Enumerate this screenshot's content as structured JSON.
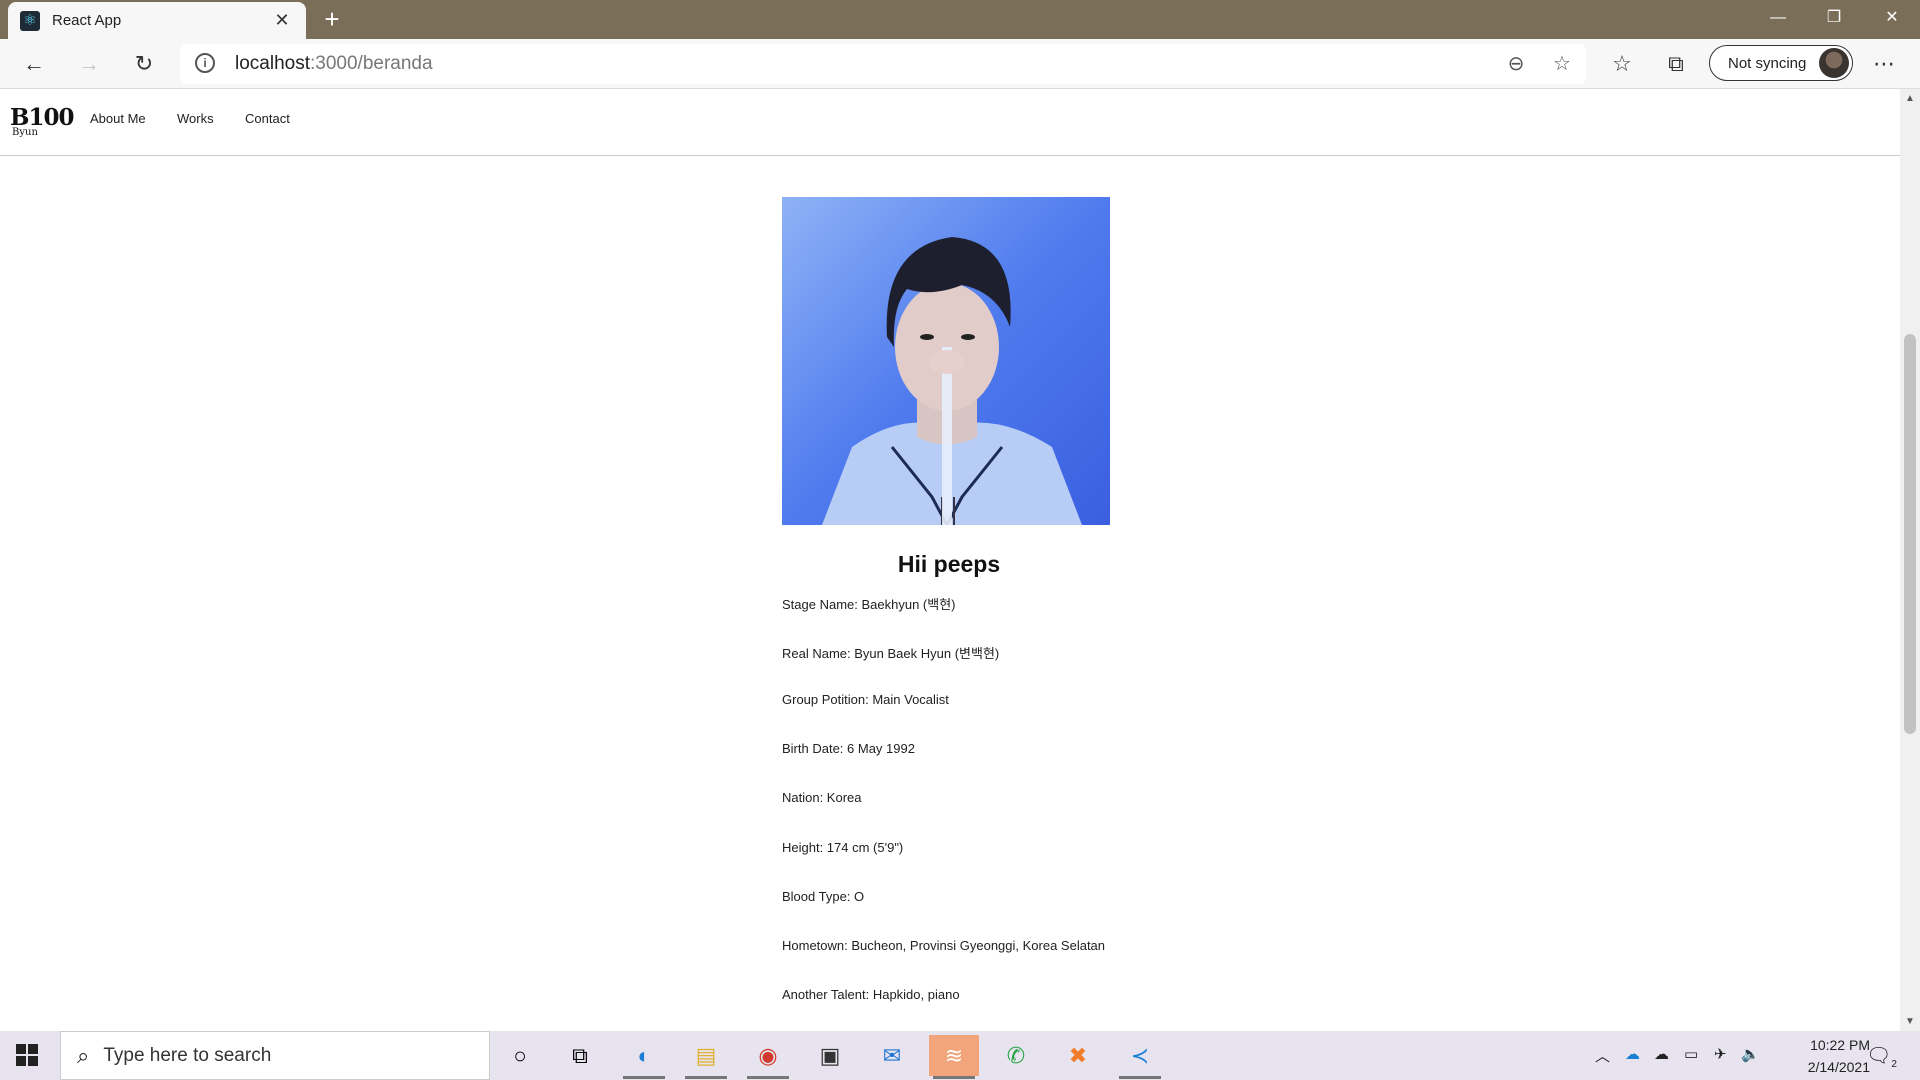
{
  "browser": {
    "tab_title": "React App",
    "tab_close": "✕",
    "new_tab": "+",
    "window_controls": {
      "minimize": "—",
      "restore": "❐",
      "close": "✕"
    },
    "url_host": "localhost",
    "url_path": ":3000/beranda",
    "sync_label": "Not syncing"
  },
  "site": {
    "logo_text": "B100",
    "logo_sub": "Byun",
    "nav": [
      "About Me",
      "Works",
      "Contact"
    ],
    "heading": "Hii peeps",
    "info": [
      "Stage Name: Baekhyun (백현)",
      "Real Name: Byun Baek Hyun (변백현)",
      "Group Potition: Main Vocalist",
      "Birth Date: 6 May 1992",
      "Nation: Korea",
      "Height: 174 cm (5'9\")",
      "Blood Type: O",
      "Hometown: Bucheon, Provinsi Gyeonggi, Korea Selatan",
      "Another Talent: Hapkido, piano"
    ]
  },
  "taskbar": {
    "search_placeholder": "Type here to search",
    "time": "10:22 PM",
    "date": "2/14/2021",
    "notification_count": "2"
  },
  "colors": {
    "titlebar": "#7b6e59",
    "toolbar": "#f7f7f7",
    "taskbar": "#e8e4ef",
    "photo_blue": "#4a77ec"
  }
}
